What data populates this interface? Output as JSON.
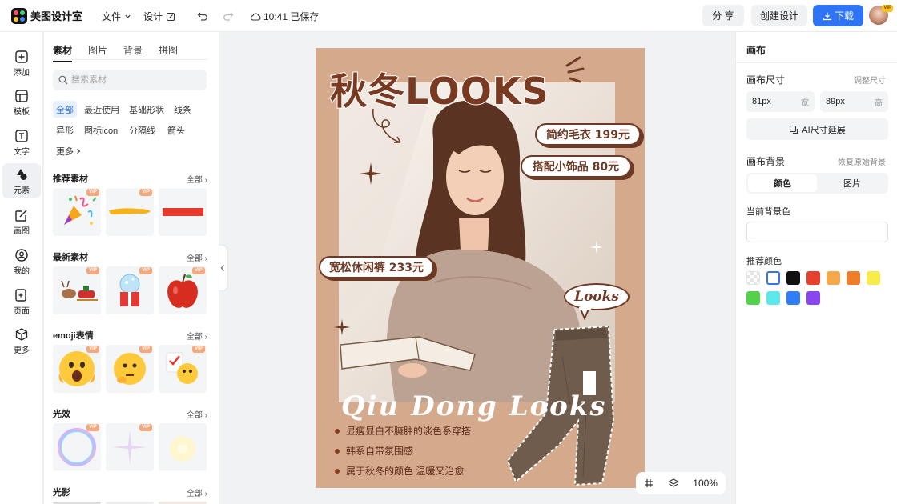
{
  "app": {
    "name": "美图设计室"
  },
  "topbar": {
    "file_menu": "文件",
    "design_menu": "设计",
    "save_status": "10:41 已保存",
    "share_label": "分 享",
    "create_label": "创建设计",
    "download_label": "下载",
    "avatar_badge": "VIP"
  },
  "rail": {
    "items": [
      {
        "label": "添加",
        "icon": "plus-square-icon"
      },
      {
        "label": "模板",
        "icon": "template-icon"
      },
      {
        "label": "文字",
        "icon": "text-icon"
      },
      {
        "label": "元素",
        "icon": "shapes-icon"
      },
      {
        "label": "画图",
        "icon": "edit-icon"
      },
      {
        "label": "我的",
        "icon": "user-icon"
      },
      {
        "label": "页面",
        "icon": "page-add-icon"
      },
      {
        "label": "更多",
        "icon": "cube-icon"
      }
    ]
  },
  "materials": {
    "tabs": [
      "素材",
      "图片",
      "背景",
      "拼图"
    ],
    "search_placeholder": "搜索素材",
    "chips": [
      "全部",
      "最近使用",
      "基础形状",
      "线条",
      "异形",
      "图标icon",
      "分隔线",
      "箭头",
      "更多"
    ],
    "all_label": "全部",
    "vip_label": "VIP",
    "sections": [
      "推荐素材",
      "最新素材",
      "emoji表情",
      "光效",
      "光影"
    ]
  },
  "poster": {
    "title": "秋冬LOOKS",
    "tags": [
      "简约毛衣 199元",
      "搭配小饰品 80元",
      "宽松休闲裤 233元"
    ],
    "bubble": "Looks",
    "script": "Qiu Dong Looks",
    "bullets": [
      "显瘦显白不臃肿的淡色系穿搭",
      "韩系自带氛围感",
      "属于秋冬的颜色 温暖又治愈"
    ]
  },
  "zoom": {
    "level": "100%"
  },
  "canvas_props": {
    "title": "画布",
    "size_label": "画布尺寸",
    "size_hint": "调整尺寸",
    "width_value": "81px",
    "width_unit": "宽",
    "height_value": "89px",
    "height_unit": "高",
    "ai_extend_label": "AI尺寸延展",
    "bg_label": "画布背景",
    "bg_hint": "恢复原始背景",
    "bg_tabs": [
      "颜色",
      "图片"
    ],
    "current_bg_label": "当前背景色",
    "recommended_label": "推荐颜色",
    "swatches": [
      "transparent",
      "#ffffff",
      "#111111",
      "#e8402c",
      "#f5a94b",
      "#ef7d2a",
      "#f7ec4a",
      "#52d24a",
      "#5ee8ec",
      "#2f7ef5",
      "#8a44f0"
    ]
  },
  "colors": {
    "accent": "#2f74f5",
    "poster_bg": "#d4a98c",
    "brown": "#6e3a26"
  }
}
